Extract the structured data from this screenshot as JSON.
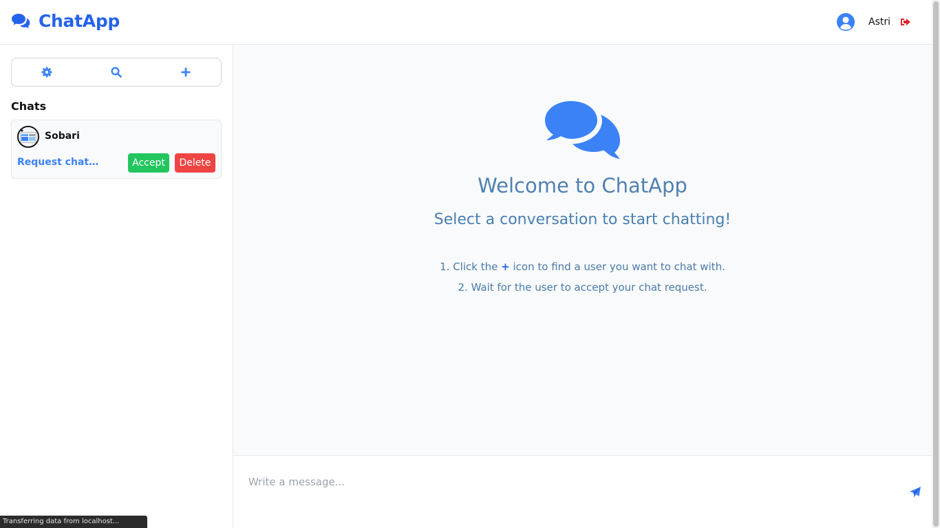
{
  "app": {
    "title": "ChatApp",
    "brand_color": "#2563eb"
  },
  "user": {
    "name": "Astri"
  },
  "sidebar": {
    "toolbar": {
      "icons": [
        "gear-icon",
        "search-icon",
        "plus-icon"
      ]
    },
    "chats_title": "Chats",
    "chats": [
      {
        "name": "Sobari",
        "status": "Request chat ...",
        "accept_label": "Accept",
        "delete_label": "Delete"
      }
    ]
  },
  "main": {
    "welcome_title": "Welcome to ChatApp",
    "welcome_subtitle": "Select a conversation to start chatting!",
    "step1_prefix": "1. Click the",
    "step1_icon": "+",
    "step1_suffix": "icon to find a user you want to chat with.",
    "step2": "2. Wait for the user to accept your chat request."
  },
  "composer": {
    "placeholder": "Write a message..."
  },
  "status_bar": {
    "text": "Transferring data from localhost..."
  },
  "colors": {
    "accept": "#22c55e",
    "delete": "#ef4444",
    "accent": "#3b82f6",
    "logout": "#dc2626"
  }
}
